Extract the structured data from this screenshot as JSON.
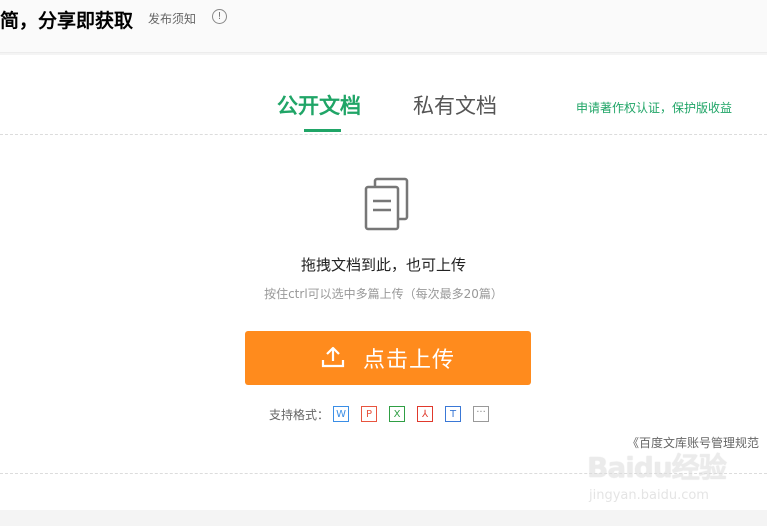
{
  "header": {
    "title": "简，分享即获取",
    "notice_link": "发布须知",
    "info_icon": "info-circle-icon"
  },
  "tabs": {
    "public_label": "公开文档",
    "private_label": "私有文档",
    "copyright_link": "申请著作权认证，保护版收益"
  },
  "upload_area": {
    "icon": "document-stack-icon",
    "drop_title": "拖拽文档到此，也可上传",
    "drop_hint": "按住ctrl可以选中多篇上传（每次最多20篇）",
    "button_label": "点击上传",
    "button_icon": "upload-icon",
    "button_color": "#ff8b1d"
  },
  "formats": {
    "label": "支持格式：",
    "items": [
      {
        "icon": "word-file-icon",
        "glyph": "W"
      },
      {
        "icon": "ppt-file-icon",
        "glyph": "P"
      },
      {
        "icon": "excel-file-icon",
        "glyph": "X"
      },
      {
        "icon": "pdf-file-icon",
        "glyph": "⅄"
      },
      {
        "icon": "txt-file-icon",
        "glyph": "T"
      },
      {
        "icon": "more-formats-icon",
        "glyph": "···"
      }
    ]
  },
  "rules_link": "《百度文库账号管理规范",
  "watermark": {
    "main": "Baidu经验",
    "sub": "jingyan.baidu.com"
  },
  "colors": {
    "accent_green": "#20a567",
    "accent_orange": "#ff8b1d"
  }
}
